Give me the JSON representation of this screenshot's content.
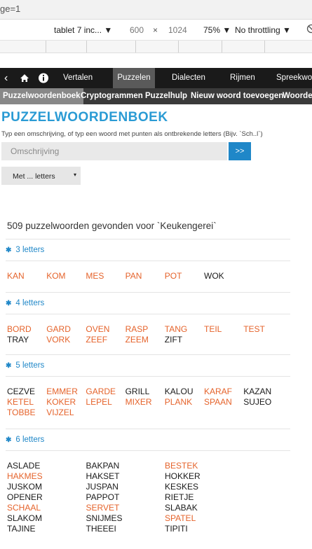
{
  "browser": {
    "url_fragment": "ge=1",
    "device": "tablet 7 inc...",
    "width": "600",
    "times": "×",
    "height": "1024",
    "zoom": "75%",
    "throttling": "No throttling"
  },
  "nav_primary": {
    "back_glyph": "‹",
    "home_glyph": "⌂",
    "info_glyph": "i",
    "items": [
      "Vertalen",
      "Puzzelen",
      "Dialecten",
      "Rijmen",
      "Spreekwo"
    ],
    "active": "Puzzelen"
  },
  "nav_secondary": {
    "items": [
      "Puzzelwoordenboek",
      "Cryptogrammen",
      "Puzzelhulp",
      "Nieuw woord toevoegen",
      "Woorden"
    ],
    "active": "Puzzelwoordenboek"
  },
  "page": {
    "title": "PUZZELWOORDENBOEK",
    "hint": "Typ een omschrijving, of typ een woord met punten als ontbrekende letters (Bijv. `Sch..l`)",
    "search_placeholder": "Omschrijving",
    "search_button": ">>",
    "select_label": "Met ... letters",
    "select_arrow": "▾",
    "result_count": "509 puzzelwoorden gevonden voor `Keukengerei`"
  },
  "sections": [
    {
      "heading": "3 letters",
      "words": [
        {
          "t": "KAN",
          "link": true
        },
        {
          "t": "KOM",
          "link": true
        },
        {
          "t": "MES",
          "link": true
        },
        {
          "t": "PAN",
          "link": true
        },
        {
          "t": "POT",
          "link": true
        },
        {
          "t": "WOK",
          "link": false
        }
      ]
    },
    {
      "heading": "4 letters",
      "words": [
        {
          "t": "BORD",
          "link": true
        },
        {
          "t": "GARD",
          "link": true
        },
        {
          "t": "OVEN",
          "link": true
        },
        {
          "t": "RASP",
          "link": true
        },
        {
          "t": "TANG",
          "link": true
        },
        {
          "t": "TEIL",
          "link": true
        },
        {
          "t": "TEST",
          "link": true
        },
        {
          "t": "TRAY",
          "link": false
        },
        {
          "t": "VORK",
          "link": true
        },
        {
          "t": "ZEEF",
          "link": true
        },
        {
          "t": "ZEEM",
          "link": true
        },
        {
          "t": "ZIFT",
          "link": false
        }
      ]
    },
    {
      "heading": "5 letters",
      "words": [
        {
          "t": "CEZVE",
          "link": false
        },
        {
          "t": "EMMER",
          "link": true
        },
        {
          "t": "GARDE",
          "link": true
        },
        {
          "t": "GRILL",
          "link": false
        },
        {
          "t": "KALOU",
          "link": false
        },
        {
          "t": "KARAF",
          "link": true
        },
        {
          "t": "KAZAN",
          "link": false
        },
        {
          "t": "KETEL",
          "link": true
        },
        {
          "t": "KOKER",
          "link": true
        },
        {
          "t": "LEPEL",
          "link": true
        },
        {
          "t": "MIXER",
          "link": true
        },
        {
          "t": "PLANK",
          "link": true
        },
        {
          "t": "SPAAN",
          "link": true
        },
        {
          "t": "SUJEO",
          "link": false
        },
        {
          "t": "TOBBE",
          "link": true
        },
        {
          "t": "VIJZEL",
          "link": true
        }
      ]
    },
    {
      "heading": "6 letters",
      "words": [
        {
          "t": "ASLADE",
          "link": false
        },
        {
          "t": "BAKPAN",
          "link": false
        },
        {
          "t": "BESTEK",
          "link": true
        },
        {
          "t": "HAKMES",
          "link": true
        },
        {
          "t": "HAKSET",
          "link": false
        },
        {
          "t": "HOKKER",
          "link": false
        },
        {
          "t": "JUSKOM",
          "link": false
        },
        {
          "t": "JUSPAN",
          "link": false
        },
        {
          "t": "KESKES",
          "link": false
        },
        {
          "t": "OPENER",
          "link": false
        },
        {
          "t": "PAPPOT",
          "link": false
        },
        {
          "t": "RIETJE",
          "link": false
        },
        {
          "t": "SCHAAL",
          "link": true
        },
        {
          "t": "SERVET",
          "link": true
        },
        {
          "t": "SLABAK",
          "link": false
        },
        {
          "t": "SLAKOM",
          "link": false
        },
        {
          "t": "SNIJMES",
          "link": false
        },
        {
          "t": "SPATEL",
          "link": true
        },
        {
          "t": "TAJINE",
          "link": false
        },
        {
          "t": "THEEEI",
          "link": false
        },
        {
          "t": "TIPITI",
          "link": false
        }
      ]
    }
  ],
  "colors": {
    "accent_blue": "#2a9bd4",
    "link_orange": "#e5632b",
    "nav_dark": "#1a1a1a"
  }
}
